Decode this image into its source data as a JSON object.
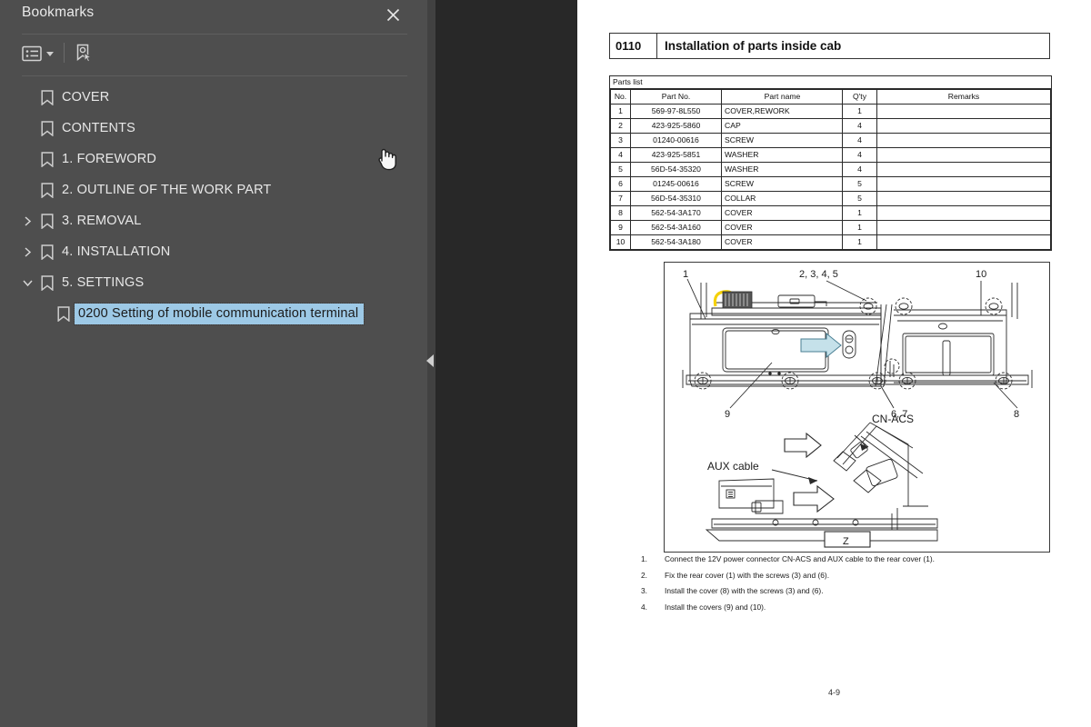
{
  "sidebar": {
    "title": "Bookmarks",
    "close_icon": "close-icon",
    "toolbar": {
      "options_label": "list-options-icon",
      "new_bookmark_label": "new-bookmark-icon"
    },
    "items": [
      {
        "label": "COVER",
        "depth": 0,
        "twisty": "none",
        "selected": false
      },
      {
        "label": "CONTENTS",
        "depth": 0,
        "twisty": "none",
        "selected": false
      },
      {
        "label": "1. FOREWORD",
        "depth": 0,
        "twisty": "none",
        "selected": false
      },
      {
        "label": "2. OUTLINE OF THE WORK PART",
        "depth": 0,
        "twisty": "none",
        "selected": false
      },
      {
        "label": "3. REMOVAL",
        "depth": 0,
        "twisty": "collapsed",
        "selected": false
      },
      {
        "label": "4. INSTALLATION",
        "depth": 0,
        "twisty": "collapsed",
        "selected": false
      },
      {
        "label": "5. SETTINGS",
        "depth": 0,
        "twisty": "expanded",
        "selected": false
      },
      {
        "label": "0200 Setting of mobile communication terminal",
        "depth": 1,
        "twisty": "none",
        "selected": true
      }
    ]
  },
  "document": {
    "header": {
      "number": "0110",
      "title": "Installation of parts inside cab"
    },
    "parts_list": {
      "caption": "Parts list",
      "columns": [
        "No.",
        "Part No.",
        "Part name",
        "Q'ty",
        "Remarks"
      ],
      "rows": [
        {
          "no": "1",
          "part_no": "569-97-8L550",
          "name": "COVER,REWORK",
          "qty": "1",
          "remarks": ""
        },
        {
          "no": "2",
          "part_no": "423-925-5860",
          "name": "CAP",
          "qty": "4",
          "remarks": ""
        },
        {
          "no": "3",
          "part_no": "01240-00616",
          "name": "SCREW",
          "qty": "4",
          "remarks": ""
        },
        {
          "no": "4",
          "part_no": "423-925-5851",
          "name": "WASHER",
          "qty": "4",
          "remarks": ""
        },
        {
          "no": "5",
          "part_no": "56D-54-35320",
          "name": "WASHER",
          "qty": "4",
          "remarks": ""
        },
        {
          "no": "6",
          "part_no": "01245-00616",
          "name": "SCREW",
          "qty": "5",
          "remarks": ""
        },
        {
          "no": "7",
          "part_no": "56D-54-35310",
          "name": "COLLAR",
          "qty": "5",
          "remarks": ""
        },
        {
          "no": "8",
          "part_no": "562-54-3A170",
          "name": "COVER",
          "qty": "1",
          "remarks": ""
        },
        {
          "no": "9",
          "part_no": "562-54-3A160",
          "name": "COVER",
          "qty": "1",
          "remarks": ""
        },
        {
          "no": "10",
          "part_no": "562-54-3A180",
          "name": "COVER",
          "qty": "1",
          "remarks": ""
        }
      ]
    },
    "figure": {
      "callouts": [
        "1",
        "2, 3, 4, 5",
        "10",
        "9",
        "6, 7",
        "8"
      ],
      "detail_labels": [
        "CN-ACS",
        "AUX cable"
      ],
      "view_marks": [
        "Z",
        "Z"
      ],
      "arrow_color": "#c5e1ea",
      "highlight_color": "#f5d108"
    },
    "steps": [
      {
        "n": "1.",
        "text": "Connect the 12V power connector CN-ACS and AUX cable to the rear cover (1)."
      },
      {
        "n": "2.",
        "text": "Fix the rear cover (1) with the screws (3) and (6)."
      },
      {
        "n": "3.",
        "text": "Install the cover (8) with the screws (3) and (6)."
      },
      {
        "n": "4.",
        "text": "Install the covers (9) and (10)."
      }
    ],
    "page_number": "4-9"
  },
  "colors": {
    "sidebar_bg": "#4e4e4e",
    "gutter_bg": "#282828",
    "selection_bg": "#9dc9e6",
    "page_bg": "#ffffff"
  }
}
